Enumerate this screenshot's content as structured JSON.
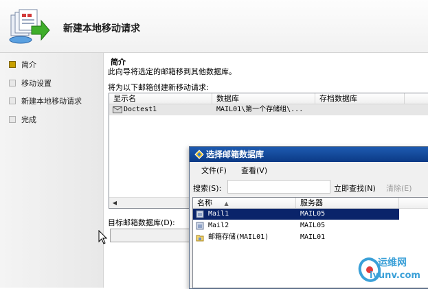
{
  "header": {
    "title": "新建本地移动请求"
  },
  "nav": {
    "items": [
      {
        "label": "简介",
        "active": true
      },
      {
        "label": "移动设置",
        "active": false
      },
      {
        "label": "新建本地移动请求",
        "active": false
      },
      {
        "label": "完成",
        "active": false
      }
    ]
  },
  "main": {
    "section_title": "简介",
    "intro_text": "此向导将选定的邮箱移到其他数据库。",
    "list_label": "将为以下邮箱创建新移动请求:",
    "list": {
      "columns": [
        "显示名",
        "数据库",
        "存档数据库"
      ],
      "rows": [
        {
          "display_name": "Doctest1",
          "database": "MAIL01\\第一个存储组\\...",
          "archive": ""
        }
      ]
    },
    "target_label": "目标邮箱数据库(D):",
    "target_value": ""
  },
  "dialog": {
    "title": "选择邮箱数据库",
    "menu": {
      "file": "文件(F)",
      "view": "查看(V)"
    },
    "search_label": "搜索(S):",
    "search_value": "",
    "find_now": "立即查找(N)",
    "clear": "清除(E)",
    "columns": [
      "名称",
      "服务器"
    ],
    "rows": [
      {
        "name": "Mail1",
        "server": "MAIL05",
        "selected": true,
        "icon": "database-icon"
      },
      {
        "name": "Mail2",
        "server": "MAIL05",
        "selected": false,
        "icon": "database-icon"
      },
      {
        "name": "邮箱存储(MAIL01)",
        "server": "MAIL01",
        "selected": false,
        "icon": "database-folder-icon"
      }
    ]
  },
  "watermark": {
    "line1": "运维网",
    "line2": "iyunv.com"
  },
  "colors": {
    "titlebar": "#0b3a86",
    "selection": "#0a246a",
    "active_step": "#c8a000"
  }
}
